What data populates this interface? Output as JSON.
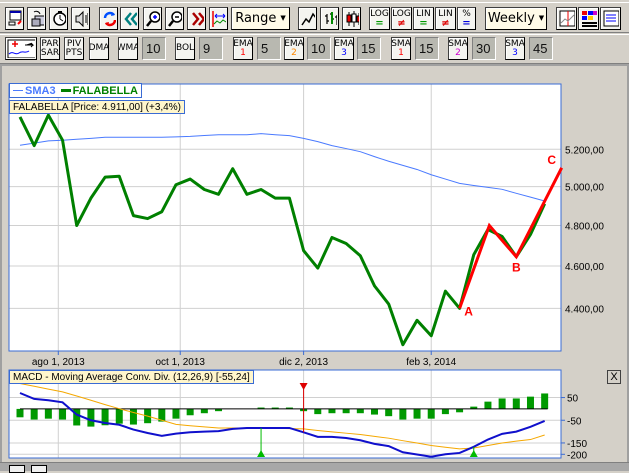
{
  "toolbar1": {
    "buttons": [
      {
        "name": "new-window-icon"
      },
      {
        "name": "copy-chart-icon"
      },
      {
        "name": "timer-icon"
      },
      {
        "name": "sound-icon"
      },
      {
        "name": "refresh-icon"
      },
      {
        "name": "rewind-icon"
      },
      {
        "name": "zoom-in-icon"
      },
      {
        "name": "zoom-out-icon"
      },
      {
        "name": "fast-forward-icon"
      },
      {
        "name": "fit-range-icon"
      }
    ],
    "range_label": "Range",
    "chart_types": [
      "line-chart-icon",
      "bar-chart-icon",
      "candlestick-icon"
    ],
    "scale_buttons": [
      {
        "top": "LOG",
        "bottom": "=",
        "color": "#009900"
      },
      {
        "top": "LOG",
        "bottom": "≠",
        "color": "#dd0000"
      },
      {
        "top": "LIN",
        "bottom": "=",
        "color": "#009900"
      },
      {
        "top": "LIN",
        "bottom": "≠",
        "color": "#dd0000"
      },
      {
        "top": "%",
        "bottom": "=",
        "color": "#0000dd"
      }
    ],
    "period_label": "Weekly",
    "right_buttons": [
      "chart-settings-icon",
      "colors-icon",
      "indicators-icon"
    ]
  },
  "toolbar2": {
    "add_indicator": "add-indicator-icon",
    "par_sar": [
      "PAR",
      "SAR"
    ],
    "piv_pts": [
      "PIV",
      "PTS"
    ],
    "dma": "DMA",
    "wma": {
      "label": "WMA",
      "value": "10"
    },
    "bol": {
      "label": "BOL",
      "value": "9"
    },
    "ema": [
      {
        "label": "EMA",
        "num": "1",
        "num_color": "#ff0000",
        "value": "5"
      },
      {
        "label": "EMA",
        "num": "2",
        "num_color": "#ff8800",
        "value": "10"
      },
      {
        "label": "EMA",
        "num": "3",
        "num_color": "#0000ff",
        "value": "15"
      }
    ],
    "sma": [
      {
        "label": "SMA",
        "num": "1",
        "num_color": "#ff0000",
        "value": "15"
      },
      {
        "label": "SMA",
        "num": "2",
        "num_color": "#cc00cc",
        "value": "30"
      },
      {
        "label": "SMA",
        "num": "3",
        "num_color": "#0000ff",
        "value": "45"
      }
    ]
  },
  "legend": {
    "sma_label": "SMA3",
    "sma_color": "#4a7aff",
    "price_label": "FALABELLA",
    "price_color": "#008000"
  },
  "price_tooltip": "FALABELLA [Price: 4.911,00] (+3,4%)",
  "chart_data": [
    {
      "type": "line",
      "scale": "log",
      "grid": true,
      "legend": "top-left",
      "ylim": [
        4200,
        5420
      ],
      "y_ticks": [
        5200,
        5000,
        4800,
        4600,
        4400
      ],
      "y_tick_labels": [
        "5.200,00",
        "5.000,00",
        "4.800,00",
        "4.600,00",
        "4.400,00"
      ],
      "x_ticks": [
        {
          "index": 2.7,
          "label": "ago 1, 2013"
        },
        {
          "index": 11.3,
          "label": "oct 1, 2013"
        },
        {
          "index": 20,
          "label": "dic 2, 2013"
        },
        {
          "index": 29,
          "label": "feb 3, 2014"
        }
      ],
      "series": [
        {
          "name": "FALABELLA",
          "color": "#008000",
          "values": [
            5380,
            5220,
            5390,
            5250,
            4800,
            4940,
            5050,
            5055,
            4850,
            4835,
            4870,
            5010,
            5040,
            4985,
            4960,
            5095,
            4960,
            4985,
            4940,
            4940,
            4675,
            4590,
            4740,
            4710,
            4650,
            4505,
            4420,
            4235,
            4345,
            4275,
            4480,
            4400,
            4655,
            4780,
            4745,
            4645,
            4755,
            4911
          ]
        },
        {
          "name": "SMA3",
          "color": "#4a7aff",
          "values": [
            5222,
            5234,
            5246,
            5250,
            5255,
            5260,
            5266,
            5266,
            5266,
            5266,
            5266,
            5268,
            5271,
            5276,
            5280,
            5280,
            5280,
            5286,
            5280,
            5275,
            5260,
            5242,
            5220,
            5204,
            5187,
            5160,
            5135,
            5113,
            5091,
            5063,
            5040,
            5017,
            5006,
            4996,
            4986,
            4965,
            4945,
            4925
          ]
        }
      ],
      "annotations": [
        {
          "label": "A",
          "index": 31,
          "value": 4400
        },
        {
          "label": "",
          "index": 33.1,
          "value": 4800
        },
        {
          "label": "B",
          "index": 35,
          "value": 4645
        },
        {
          "label": "C",
          "index": 38.2,
          "value": 5100
        }
      ],
      "annotation_color": "#ff0000"
    },
    {
      "type": "bar+line",
      "title": "MACD - Moving Average Conv. Div. (12,26,9) [-55,24]",
      "ylim": [
        -210,
        130
      ],
      "y_ticks": [
        50,
        -50,
        -150,
        -200
      ],
      "y_tick_labels": [
        "50",
        "-50",
        "-150",
        "-200"
      ],
      "histogram": [
        -37,
        -47,
        -43,
        -47,
        -73,
        -78,
        -72,
        -65,
        -69,
        -63,
        -56,
        -43,
        -28,
        -19,
        -10,
        0,
        0,
        6,
        6,
        6,
        -10,
        -23,
        -19,
        -19,
        -19,
        -25,
        -32,
        -47,
        -43,
        -43,
        -23,
        -15,
        10,
        32,
        46,
        46,
        54,
        68
      ],
      "histogram_color": "#009900",
      "macd": {
        "color": "#1010cc",
        "values": [
          70,
          44,
          38,
          29,
          -25,
          -50,
          -62,
          -70,
          -91,
          -106,
          -119,
          -109,
          -103,
          -100,
          -98,
          -88,
          -84,
          -84,
          -84,
          -84,
          -103,
          -123,
          -123,
          -128,
          -138,
          -154,
          -164,
          -191,
          -201,
          -211,
          -200,
          -194,
          -167,
          -135,
          -110,
          -100,
          -79,
          -53
        ]
      },
      "signal": {
        "color": "#f5a800",
        "values": [
          112,
          100,
          87,
          75,
          57,
          38,
          19,
          1,
          -16,
          -32,
          -50,
          -68,
          -74,
          -79,
          -84,
          -84,
          -84,
          -84,
          -85,
          -87,
          -88,
          -95,
          -101,
          -107,
          -113,
          -121,
          -129,
          -140,
          -150,
          -161,
          -169,
          -176,
          -172,
          -161,
          -150,
          -142,
          -135,
          -115
        ]
      },
      "signals": [
        {
          "type": "sell",
          "index": 20,
          "color": "#dd0000"
        },
        {
          "type": "buy",
          "index": 17,
          "color": "#00bb00"
        },
        {
          "type": "buy",
          "index": 32,
          "color": "#00bb00"
        }
      ]
    }
  ],
  "macd_close": "X"
}
